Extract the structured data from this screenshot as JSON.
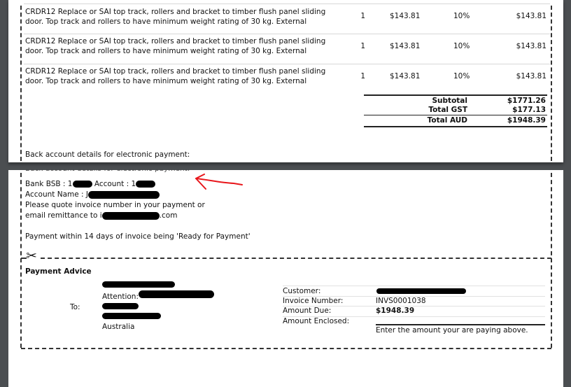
{
  "line_items": [
    {
      "description": "CRDR12 Replace or SAI top track, rollers and bracket to timber flush panel sliding door. Top track and rollers to have minimum weight rating of 30 kg. External",
      "qty": "1",
      "unit_price": "$143.81",
      "tax": "10%",
      "amount": "$143.81"
    },
    {
      "description": "CRDR12 Replace or SAI top track, rollers and bracket to timber flush panel sliding door. Top track and rollers to have minimum weight rating of 30 kg. External",
      "qty": "1",
      "unit_price": "$143.81",
      "tax": "10%",
      "amount": "$143.81"
    },
    {
      "description": "CRDR12 Replace or SAI top track, rollers and bracket to timber flush panel sliding door. Top track and rollers to have minimum weight rating of 30 kg. External",
      "qty": "1",
      "unit_price": "$143.81",
      "tax": "10%",
      "amount": "$143.81"
    }
  ],
  "totals": {
    "subtotal_label": "Subtotal",
    "subtotal_value": "$1771.26",
    "gst_label": "Total GST",
    "gst_value": "$177.13",
    "total_label": "Total AUD",
    "total_value": "$1948.39"
  },
  "bank": {
    "heading": "Back account details for electronic payment:",
    "bsb_label": "Bank BSB : 1",
    "account_label": "Account : 1",
    "account_name_label": "Account Name : J",
    "quote_line": "Please quote invoice number in your payment or",
    "email_prefix": "email remittance to i",
    "email_suffix": ".com",
    "terms": "Payment within 14 days of invoice being 'Ready for Payment'"
  },
  "payment_advice": {
    "title": "Payment Advice",
    "to_label": "To:",
    "attention_label": "Attention: ",
    "country": "Australia",
    "customer_label": "Customer:",
    "invoice_number_label": "Invoice Number:",
    "invoice_number": "INVS0001038",
    "amount_due_label": "Amount Due:",
    "amount_due": "$1948.39",
    "amount_enclosed_label": "Amount Enclosed:",
    "enter_amount_hint": "Enter the amount your are paying above."
  },
  "icons": {
    "scissors": "✂",
    "annotation_color": "#e8161b"
  }
}
